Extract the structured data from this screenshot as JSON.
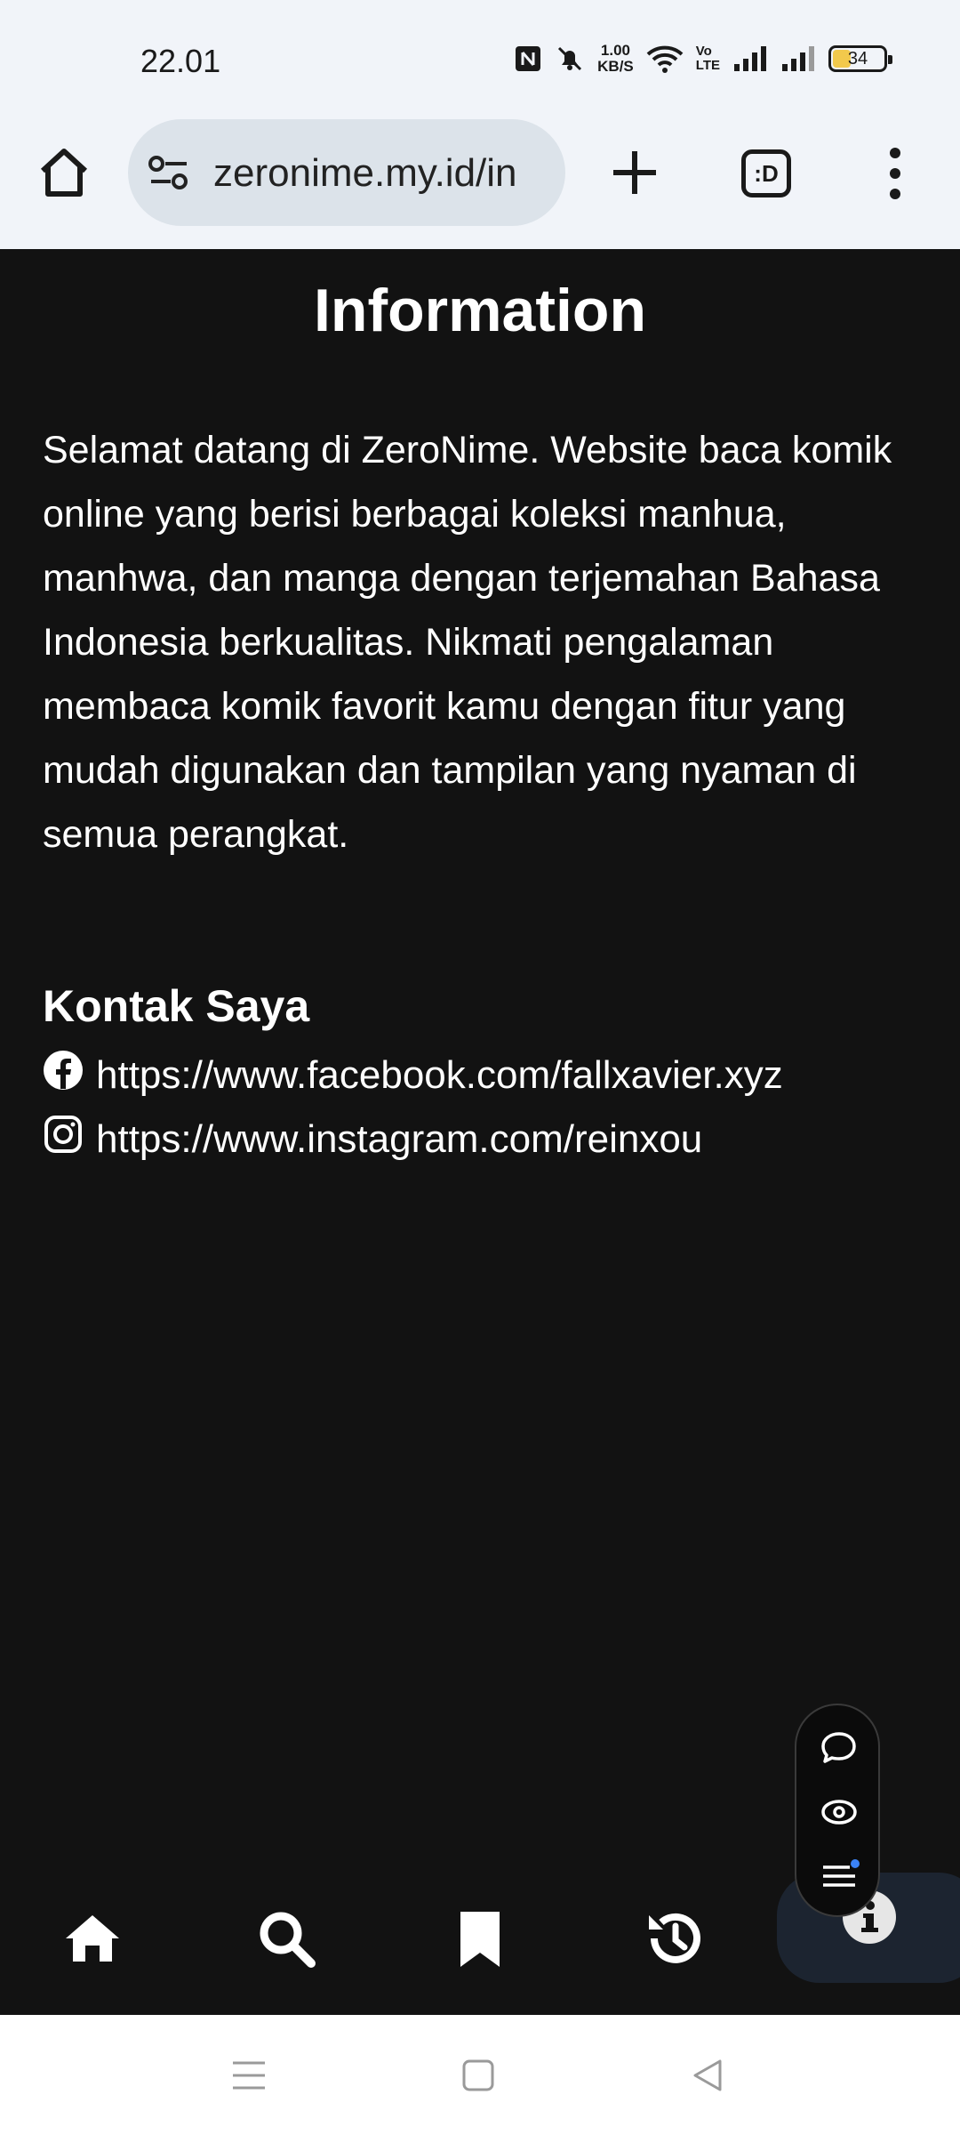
{
  "status_bar": {
    "time": "22.01",
    "net_speed_value": "1.00",
    "net_speed_unit": "KB/S",
    "volte_top": "Vo",
    "volte_bottom": "LTE",
    "battery_level": "34",
    "battery_fraction": 0.34,
    "icons": [
      "nfc-icon",
      "bell-off-icon",
      "wifi-icon",
      "signal-icon",
      "signal-icon",
      "battery-icon"
    ]
  },
  "browser": {
    "url": "zeronime.my.id/in",
    "tab_count": ":D",
    "icons": [
      "home-icon",
      "site-settings-icon",
      "add-tab-icon",
      "tab-switcher-icon",
      "more-menu-icon"
    ]
  },
  "page": {
    "title": "Information",
    "intro": "Selamat datang di ZeroNime. Website baca komik online yang berisi berbagai koleksi manhua, manhwa, dan manga dengan terjemahan Bahasa Indonesia berkualitas. Nikmati pengalaman membaca komik favorit kamu dengan fitur yang mudah digunakan dan tampilan yang nyaman di semua perangkat.",
    "contact_heading": "Kontak Saya",
    "contacts": [
      {
        "icon": "facebook-icon",
        "url": "https://www.facebook.com/fallxavier.xyz"
      },
      {
        "icon": "instagram-icon",
        "url": "https://www.instagram.com/reinxou"
      }
    ]
  },
  "floating_menu": {
    "icons": [
      "chat-bubble-icon",
      "eye-icon",
      "list-icon"
    ]
  },
  "bottom_nav": {
    "items": [
      "home-icon",
      "search-icon",
      "bookmark-icon",
      "history-icon",
      "info-icon"
    ],
    "active": "info-icon",
    "active_color": "#1c2430"
  },
  "system_nav": {
    "icons": [
      "recents-icon",
      "home-square-icon",
      "back-triangle-icon"
    ]
  }
}
